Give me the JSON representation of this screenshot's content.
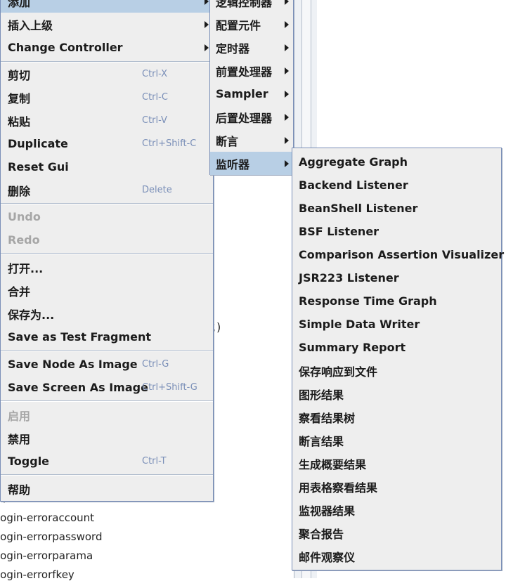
{
  "background": {
    "tree_items": [
      "login-erroraccount",
      "login-errorpassword",
      "login-errorparama",
      "login-errorfkey"
    ],
    "fragment_text": "；)"
  },
  "context_menu": {
    "items": [
      {
        "label": "添加",
        "has_submenu": true,
        "selected": true
      },
      {
        "label": "插入上级",
        "has_submenu": true
      },
      {
        "label": "Change Controller",
        "has_submenu": true
      },
      {
        "label": "剪切",
        "shortcut": "Ctrl-X"
      },
      {
        "label": "复制",
        "shortcut": "Ctrl-C"
      },
      {
        "label": "粘贴",
        "shortcut": "Ctrl-V"
      },
      {
        "label": "Duplicate",
        "shortcut": "Ctrl+Shift-C"
      },
      {
        "label": "Reset Gui"
      },
      {
        "label": "删除",
        "shortcut": "Delete"
      },
      {
        "label": "Undo",
        "disabled": true
      },
      {
        "label": "Redo",
        "disabled": true
      },
      {
        "label": "打开..."
      },
      {
        "label": "合并"
      },
      {
        "label": "保存为..."
      },
      {
        "label": "Save as Test Fragment"
      },
      {
        "label": "Save Node As Image",
        "shortcut": "Ctrl-G"
      },
      {
        "label": "Save Screen As Image",
        "shortcut": "Ctrl+Shift-G"
      },
      {
        "label": "启用",
        "disabled": true
      },
      {
        "label": "禁用"
      },
      {
        "label": "Toggle",
        "shortcut": "Ctrl-T"
      },
      {
        "label": "帮助"
      }
    ]
  },
  "add_submenu": {
    "items": [
      {
        "label": "逻辑控制器"
      },
      {
        "label": "配置元件"
      },
      {
        "label": "定时器"
      },
      {
        "label": "前置处理器"
      },
      {
        "label": "Sampler"
      },
      {
        "label": "后置处理器"
      },
      {
        "label": "断言"
      },
      {
        "label": "监听器",
        "selected": true
      }
    ]
  },
  "listener_submenu": {
    "items": [
      {
        "label": "Aggregate Graph"
      },
      {
        "label": "Backend Listener"
      },
      {
        "label": "BeanShell Listener"
      },
      {
        "label": "BSF Listener"
      },
      {
        "label": "Comparison Assertion Visualizer"
      },
      {
        "label": "JSR223 Listener"
      },
      {
        "label": "Response Time Graph"
      },
      {
        "label": "Simple Data Writer"
      },
      {
        "label": "Summary Report"
      },
      {
        "label": "保存响应到文件"
      },
      {
        "label": "图形结果"
      },
      {
        "label": "察看结果树"
      },
      {
        "label": "断言结果"
      },
      {
        "label": "生成概要结果"
      },
      {
        "label": "用表格察看结果"
      },
      {
        "label": "监视器结果"
      },
      {
        "label": "聚合报告"
      },
      {
        "label": "邮件观察仪"
      }
    ]
  },
  "colors": {
    "menu_bg": "#eeeeee",
    "selected_bg": "#b8cfe5",
    "border": "#7a8fb8",
    "disabled_text": "#a6a6a6",
    "shortcut_text": "#7a8fb8"
  }
}
